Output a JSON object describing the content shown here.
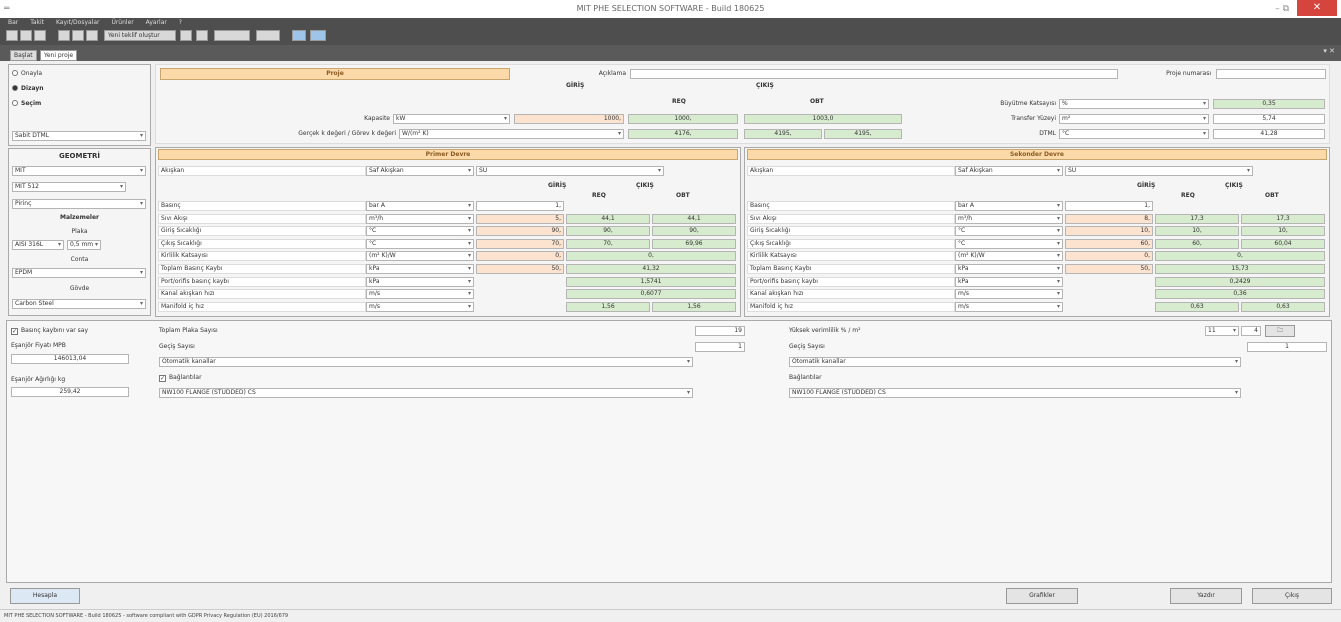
{
  "window": {
    "title": "MIT PHE SELECTION SOFTWARE - Build 180625",
    "controls": "- ⧉ ✕"
  },
  "menu": [
    "Bar",
    "Takit",
    "Kayıt/Dosyalar",
    "Ürünler",
    "Ayarlar",
    "?"
  ],
  "toolbar": {
    "button_label": "Yeni teklif oluştur"
  },
  "tabs": [
    {
      "label": "Başlat"
    },
    {
      "label": "Yeni proje"
    }
  ],
  "left": {
    "mode_options": [
      "Onayla",
      "Dizayn",
      "Seçim"
    ],
    "dtml_select": "Sabit DTML",
    "geometry_title": "GEOMETRİ",
    "geometry_select1": "MIT",
    "geometry_select2": "MIT 512",
    "geometry_select3": "Pirinç",
    "materials_title": "Malzemeler",
    "plate_label": "Plaka",
    "plate_material": "AISI 316L",
    "plate_thickness": "0,5 mm",
    "gasket_label": "Conta",
    "gasket_value": "EPDM",
    "frame_label": "Gövde",
    "frame_value": "Carbon Steel"
  },
  "project": {
    "header": "Proje",
    "description_label": "Açıklama",
    "description_value": "",
    "number_label": "Proje numarası",
    "number_value": "",
    "col_giris": "GİRİŞ",
    "col_cikis": "ÇIKIŞ",
    "col_req": "REQ",
    "col_obt": "OBT",
    "capacity_label": "Kapasite",
    "capacity_unit": "kW",
    "capacity_in": "1000,",
    "capacity_req": "1000,",
    "capacity_obt": "1003,0",
    "u_label": "Gerçek k değeri / Görev k değeri",
    "u_unit": "W/(m² K)",
    "u_req": "4176,",
    "u_obt1": "4195,",
    "u_obt2": "4195,",
    "growth_label": "Büyütme Katsayısı",
    "growth_unit": "%",
    "growth_value": "0,35",
    "area_label": "Transfer Yüzeyi",
    "area_unit": "m²",
    "area_value": "5,74",
    "dtml_label": "DTML",
    "dtml_unit": "°C",
    "dtml_value": "41,28"
  },
  "primary": {
    "header": "Primer Devre",
    "fluid_label": "Akışkan",
    "fluid_type": "Saf Akışkan",
    "fluid_name": "SU",
    "col_giris": "GİRİŞ",
    "col_cikis": "ÇIKIŞ",
    "col_req": "REQ",
    "col_obt": "OBT",
    "rows": [
      {
        "label": "Basınç",
        "unit": "bar A",
        "in": "1,",
        "req": "",
        "obt": ""
      },
      {
        "label": "Sıvı Akışı",
        "unit": "m³/h",
        "in": "5,",
        "req": "44,1",
        "obt": "44,1"
      },
      {
        "label": "Giriş Sıcaklığı",
        "unit": "°C",
        "in": "90,",
        "req": "90,",
        "obt": "90,"
      },
      {
        "label": "Çıkış Sıcaklığı",
        "unit": "°C",
        "in": "70,",
        "req": "70,",
        "obt": "69,96"
      },
      {
        "label": "Kirlilik Katsayısı",
        "unit": "(m² K)/W",
        "in": "0,",
        "span": "0,"
      },
      {
        "label": "Toplam Basınç Kaybı",
        "unit": "kPa",
        "in": "50,",
        "span": "41,32"
      },
      {
        "label": "Port/orifis basınç kaybı",
        "unit": "kPa",
        "in": "",
        "span": "1,5741"
      },
      {
        "label": "Kanal akışkan hızı",
        "unit": "m/s",
        "in": "",
        "span": "0,6077"
      },
      {
        "label": "Manifold iç hız",
        "unit": "m/s",
        "in": "",
        "req": "1,56",
        "obt": "1,56"
      }
    ]
  },
  "secondary": {
    "header": "Sekonder Devre",
    "fluid_label": "Akışkan",
    "fluid_type": "Saf Akışkan",
    "fluid_name": "SU",
    "col_giris": "GİRİŞ",
    "col_cikis": "ÇIKIŞ",
    "col_req": "REQ",
    "col_obt": "OBT",
    "rows": [
      {
        "label": "Basınç",
        "unit": "bar A",
        "in": "1,",
        "req": "",
        "obt": ""
      },
      {
        "label": "Sıvı Akışı",
        "unit": "m³/h",
        "in": "8,",
        "req": "17,3",
        "obt": "17,3"
      },
      {
        "label": "Giriş Sıcaklığı",
        "unit": "°C",
        "in": "10,",
        "req": "10,",
        "obt": "10,"
      },
      {
        "label": "Çıkış Sıcaklığı",
        "unit": "°C",
        "in": "60,",
        "req": "60,",
        "obt": "60,04"
      },
      {
        "label": "Kirlilik Katsayısı",
        "unit": "(m² K)/W",
        "in": "0,",
        "span": "0,"
      },
      {
        "label": "Toplam Basınç Kaybı",
        "unit": "kPa",
        "in": "50,",
        "span": "15,73"
      },
      {
        "label": "Port/orifis basınç kaybı",
        "unit": "kPa",
        "in": "",
        "span": "0,2429"
      },
      {
        "label": "Kanal akışkan hızı",
        "unit": "m/s",
        "in": "",
        "span": "0,36"
      },
      {
        "label": "Manifold iç hız",
        "unit": "m/s",
        "in": "",
        "req": "0,63",
        "obt": "0,63"
      }
    ]
  },
  "bottom": {
    "pressure_check": "Basınç kaybını var say",
    "price_label": "Eşanjör Fiyatı MPB",
    "price_value": "146013,04",
    "weight_label": "Eşanjör Ağırlığı kg",
    "weight_value": "259,42",
    "plate_count_label": "Toplam Plaka Sayısı",
    "plate_count_value": "19",
    "pass_label_left": "Geçiş Sayısı",
    "pass_value_left": "1",
    "channels_left": "Otomatik kanallar",
    "connections_check": "Bağlantılar",
    "connection_left": "NW100 FLANGE (STUDDED) CS",
    "excess_label": "Yüksek verimlilik % / m²",
    "excess_select": "11",
    "excess_value": "4",
    "pass_label_right": "Geçiş Sayısı",
    "pass_value_right": "1",
    "channels_right": "Otomatik kanallar",
    "connections_label_right": "Bağlantılar",
    "connection_right": "NW100 FLANGE (STUDDED) CS"
  },
  "footer_buttons": {
    "calc": "Hesapla",
    "graphs": "Grafikler",
    "print": "Yazdır",
    "exit": "Çıkış"
  },
  "status": "MIT PHE SELECTION SOFTWARE - Build 180625 - software compliant with GDPR Privacy Regulation (EU) 2016/679"
}
